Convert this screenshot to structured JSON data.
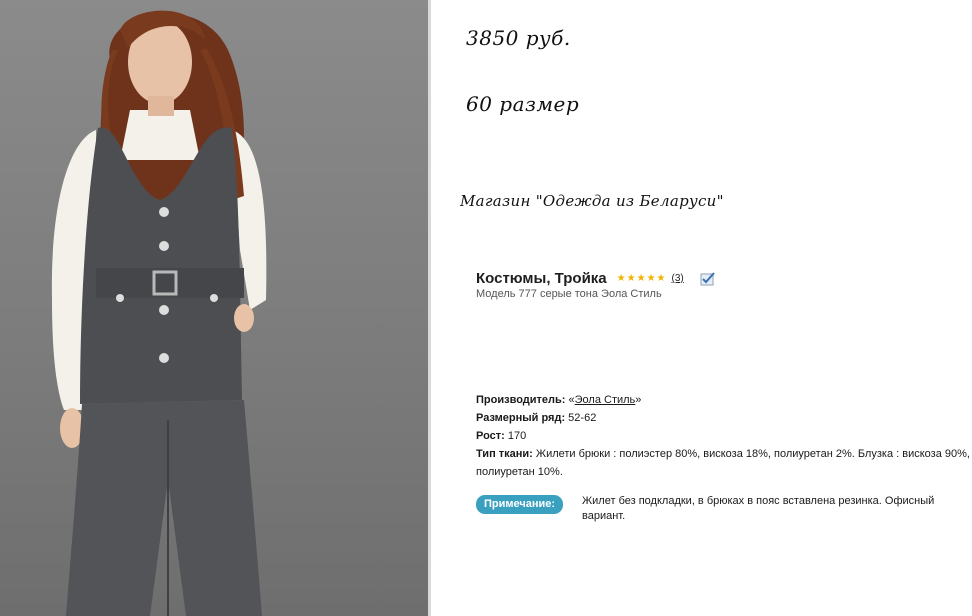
{
  "handwritten": {
    "price": "3850 руб.",
    "size": "60 размер",
    "shop": "Магазин \"Одежда из Беларуси\""
  },
  "product": {
    "title": "Костюмы, Тройка",
    "rating_count": "(3)",
    "rating_stars": 5,
    "subtitle": "Модель 777 серые тона Эола Стиль"
  },
  "specs": {
    "manufacturer_label": "Производитель:",
    "manufacturer_open": "«",
    "manufacturer_value": "Эола Стиль",
    "manufacturer_close": "»",
    "size_range_label": "Размерный ряд:",
    "size_range_value": "52-62",
    "height_label": "Рост:",
    "height_value": "170",
    "fabric_label": "Тип ткани:",
    "fabric_value": "Жилети брюки : полиэстер 80%, вискоза 18%, полиуретан 2%. Блузка : вискоза 90%, полиуретан 10%."
  },
  "note": {
    "badge": "Примечание:",
    "text": "Жилет без подкладки, в брюках в пояс вставлена резинка. Офисный вариант."
  },
  "colors": {
    "badge": "#3aa0c0",
    "star": "#f3b200",
    "vest": "#4d4e52",
    "blouse": "#f4f1ea",
    "hair": "#7a3a1e"
  },
  "icons": [
    "star-icon",
    "check-icon"
  ]
}
